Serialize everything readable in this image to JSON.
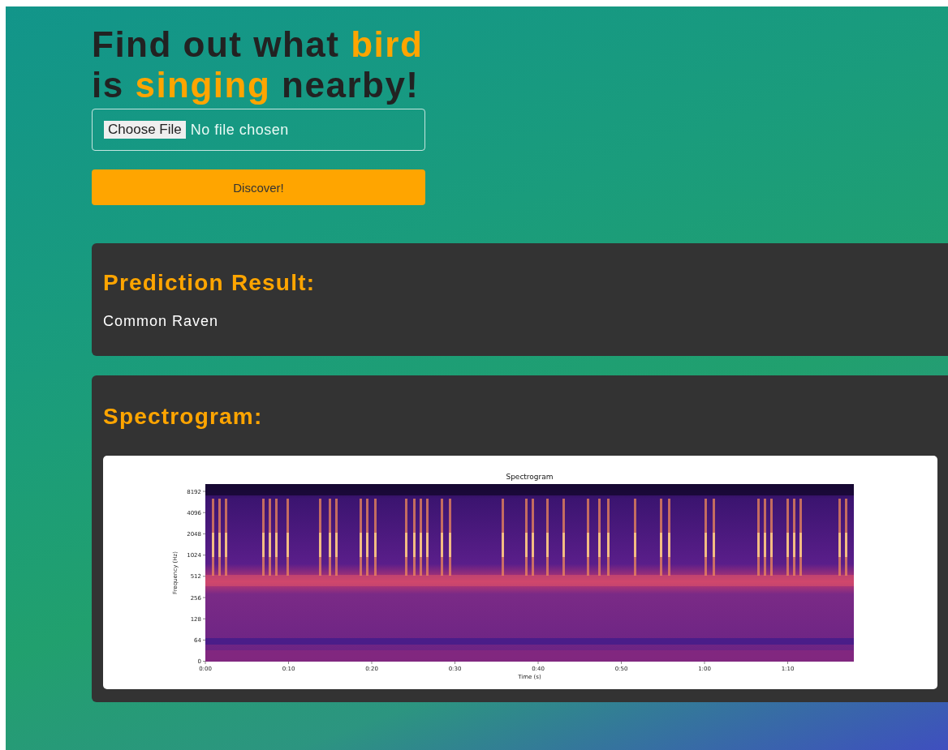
{
  "heading": [
    {
      "text": "Find out what ",
      "highlight": false
    },
    {
      "text": "bird",
      "highlight": true
    },
    {
      "text": " is ",
      "highlight": false
    },
    {
      "text": "singing",
      "highlight": true
    },
    {
      "text": " nearby!",
      "highlight": false
    }
  ],
  "file_input": {
    "button": "Choose File",
    "status": "No file chosen"
  },
  "submit_button": "Discover!",
  "prediction": {
    "title": "Prediction Result:",
    "result": "Common Raven"
  },
  "spectrogram": {
    "title": "Spectrogram:",
    "plot": {
      "title": "Spectrogram",
      "xlabel": "Time (s)",
      "ylabel": "Frequency (Hz)",
      "xticks": [
        "0:00",
        "0:10",
        "0:20",
        "0:30",
        "0:40",
        "0:50",
        "1:00",
        "1:10"
      ],
      "yticks": [
        "8192",
        "4096",
        "2048",
        "1024",
        "512",
        "256",
        "128",
        "64",
        "0"
      ]
    }
  }
}
